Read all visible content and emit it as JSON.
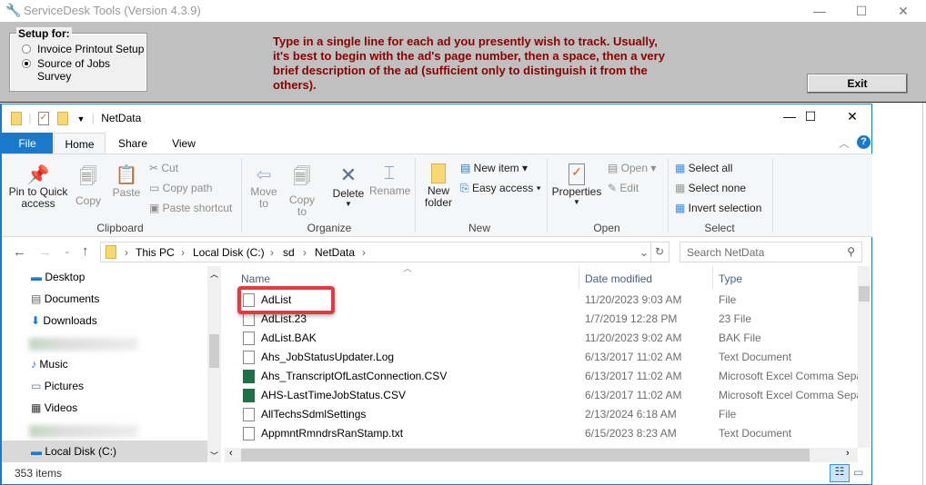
{
  "app": {
    "title": "ServiceDesk Tools (Version 4.3.9)",
    "setup_label": "Setup for:",
    "options": [
      {
        "label": "Invoice Printout Setup",
        "selected": false
      },
      {
        "label": "Source of Jobs Survey",
        "selected": true
      }
    ],
    "instructions": "Type in a single line for each ad you presently wish to track. Usually, it's best to begin with the ad's page number, then a space, then a very brief description of the ad (sufficient only to distinguish it from the others).",
    "exit_label": "Exit"
  },
  "explorer": {
    "title": "NetData",
    "tabs": [
      "File",
      "Home",
      "Share",
      "View"
    ],
    "ribbon": {
      "clipboard": {
        "label": "Clipboard",
        "pin": "Pin to Quick access",
        "copy": "Copy",
        "paste": "Paste",
        "cut": "Cut",
        "copy_path": "Copy path",
        "paste_shortcut": "Paste shortcut"
      },
      "organize": {
        "label": "Organize",
        "move_to": "Move to",
        "copy_to": "Copy to",
        "delete": "Delete",
        "rename": "Rename"
      },
      "new": {
        "label": "New",
        "new_folder": "New folder",
        "new_item": "New item",
        "easy_access": "Easy access"
      },
      "open": {
        "label": "Open",
        "properties": "Properties",
        "open": "Open",
        "edit": "Edit"
      },
      "select": {
        "label": "Select",
        "select_all": "Select all",
        "select_none": "Select none",
        "invert": "Invert selection"
      }
    },
    "breadcrumb": [
      "This PC",
      "Local Disk (C:)",
      "sd",
      "NetData"
    ],
    "search_placeholder": "Search NetData",
    "nav": [
      "Desktop",
      "Documents",
      "Downloads",
      "Music",
      "Pictures",
      "Videos",
      "Local Disk (C:)"
    ],
    "columns": [
      "Name",
      "Date modified",
      "Type"
    ],
    "files": [
      {
        "name": "AdList",
        "date": "11/20/2023 9:03 AM",
        "type": "File",
        "icon": "file"
      },
      {
        "name": "AdList.23",
        "date": "1/7/2019 12:28 PM",
        "type": "23 File",
        "icon": "file"
      },
      {
        "name": "AdList.BAK",
        "date": "11/20/2023 9:02 AM",
        "type": "BAK File",
        "icon": "file"
      },
      {
        "name": "Ahs_JobStatusUpdater.Log",
        "date": "6/13/2017 11:02 AM",
        "type": "Text Document",
        "icon": "text"
      },
      {
        "name": "Ahs_TranscriptOfLastConnection.CSV",
        "date": "6/13/2017 11:02 AM",
        "type": "Microsoft Excel Comma Sepa",
        "icon": "excel"
      },
      {
        "name": "AHS-LastTimeJobStatus.CSV",
        "date": "6/13/2017 11:02 AM",
        "type": "Microsoft Excel Comma Sepa",
        "icon": "excel"
      },
      {
        "name": "AllTechsSdmlSettings",
        "date": "2/13/2024 6:18 AM",
        "type": "File",
        "icon": "file"
      },
      {
        "name": "AppmntRmndrsRanStamp.txt",
        "date": "6/15/2023 8:23 AM",
        "type": "Text Document",
        "icon": "text"
      }
    ],
    "status": "353 items",
    "highlight_color": "#e8383d"
  }
}
